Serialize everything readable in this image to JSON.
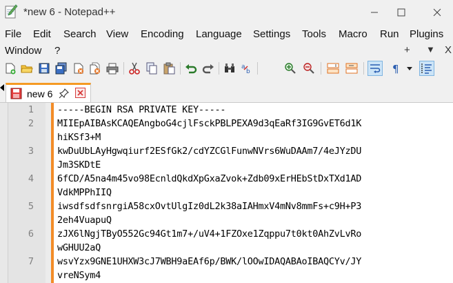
{
  "window": {
    "title": "*new 6 - Notepad++",
    "controls": [
      "minimize",
      "maximize",
      "close"
    ]
  },
  "menu": {
    "items": [
      "File",
      "Edit",
      "Search",
      "View",
      "Encoding",
      "Language",
      "Settings",
      "Tools",
      "Macro",
      "Run",
      "Plugins",
      "Window",
      "?"
    ],
    "right_controls": [
      "+",
      "▼",
      "X"
    ]
  },
  "toolbar": {
    "icons": [
      "new-file",
      "open-file",
      "save",
      "save-all",
      "close",
      "close-all",
      "print",
      "cut",
      "copy",
      "paste",
      "undo",
      "redo",
      "find",
      "replace",
      "zoom-in",
      "zoom-out",
      "sync-vertical",
      "sync-horizontal",
      "word-wrap",
      "show-all-characters",
      "indent-guide"
    ]
  },
  "tabs": [
    {
      "label": "new 6",
      "modified": true,
      "active": true
    }
  ],
  "editor": {
    "lines": [
      {
        "number": "1",
        "text": "-----BEGIN RSA PRIVATE KEY-----",
        "wrap": ""
      },
      {
        "number": "2",
        "text": "MIIEpAIBAsKCAQEAngboG4cjlFsckPBLPEXA9d3qEaRf3IG9GvET6d1K",
        "wrap": "hiKSf3+M"
      },
      {
        "number": "3",
        "text": "kwDuUbLAyHgwqiurf2ESfGk2/cdYZCGlFunwNVrs6WuDAAm7/4eJYzDU",
        "wrap": "Jm3SKDtE"
      },
      {
        "number": "4",
        "text": "6fCD/A5na4m45vo98EcnldQkdXpGxaZvok+Zdb09xErHEbStDxTXd1AD",
        "wrap": "VdkMPPhIIQ"
      },
      {
        "number": "5",
        "text": "iwsdfsdfsnrgiA58cxOvtUlgIz0dL2k38aIAHmxV4mNv8mmFs+c9H+P3",
        "wrap": "2eh4VuapuQ"
      },
      {
        "number": "6",
        "text": "zJX6lNgjTByO552Gc94Gt1m7+/uV4+1FZOxe1Zqppu7t0kt0AhZvLvRo",
        "wrap": "wGHUU2aQ"
      },
      {
        "number": "7",
        "text": "wsvYzx9GNE1UHXW3cJ7WBH9aEAf6p/BWK/lOOwIDAQABAoIBAQCYv/JY",
        "wrap": "vreNSym4"
      }
    ]
  },
  "colors": {
    "change_bar": "#f28c28",
    "tab_accent": "#f59a23",
    "close_red": "#d63a3a"
  }
}
